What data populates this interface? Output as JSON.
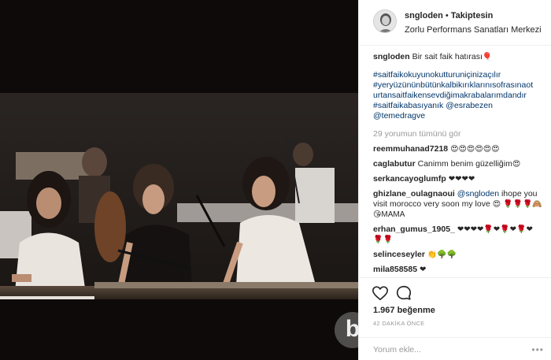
{
  "post": {
    "username": "sngloden",
    "separator": "•",
    "follow_label": "Takiptesin",
    "location": "Zorlu Performans Sanatları Merkezi"
  },
  "caption": {
    "username": "sngloden",
    "text": "Bir sait faik hatırası",
    "emoji": "🎈",
    "hashtags": "#saitfaikokuyunokutturuniçinizaçılır #yeryüzününbütünkalbikırıklarınısofrasınaot urtansaitfaikensevdiğimakrabalarımdandır #saitfaikabasıyanık",
    "mention1": "@esrabezen",
    "mention2": "@temedragve"
  },
  "view_all_comments": "29 yorumun tümünü gör",
  "comments": [
    {
      "username": "reemmuhanad7218",
      "text": "",
      "emoji": "😍😍😍😍😍😍"
    },
    {
      "username": "caglabutur",
      "text": "Canimm benim güzelliğim",
      "emoji": "😍"
    },
    {
      "username": "serkancayoglumfp",
      "text": "",
      "emoji": "❤❤❤❤"
    },
    {
      "username": "ghizlane_oulagnaoui",
      "mention": "@sngloden",
      "text": "ihope you visit morocco very soon my love",
      "emoji": "😍",
      "extra": "🌹🌹🌹🙈😘MAMA"
    },
    {
      "username": "erhan_gumus_1905_",
      "text": "",
      "emoji": "❤❤❤❤🌹❤🌹❤🌹❤🌹🌹"
    },
    {
      "username": "selinceseyler",
      "text": "",
      "emoji": "👏🌳🌳"
    },
    {
      "username": "mila858585",
      "text": "",
      "emoji": "❤"
    }
  ],
  "likes": "1.967 beğenme",
  "timestamp": "42 DAKİKA ÖNCE",
  "add_comment_placeholder": "Yorum ekle...",
  "more_label": "•••",
  "watermark_letter": "b",
  "icons": {
    "like": "heart-icon",
    "comment": "comment-bubble-icon"
  }
}
